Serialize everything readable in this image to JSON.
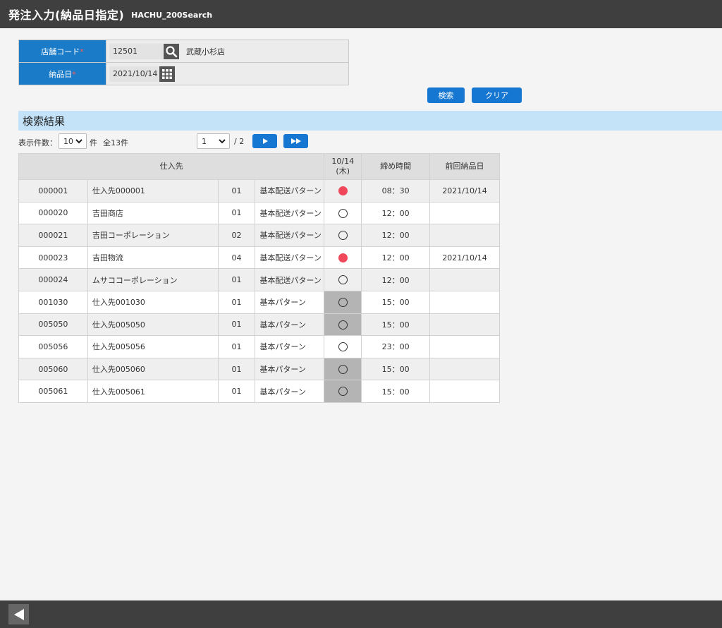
{
  "header": {
    "title": "発注入力(納品日指定)",
    "code": "HACHU_200Search"
  },
  "form": {
    "store": {
      "label": "店舗コード",
      "required_mark": "*",
      "value": "12501",
      "name": "武蔵小杉店",
      "search_icon": "search-icon"
    },
    "delivery": {
      "label": "納品日",
      "required_mark": "*",
      "value": "2021/10/14",
      "calendar_icon": "calendar-grid-icon"
    }
  },
  "actions": {
    "search_label": "検索",
    "clear_label": "クリア"
  },
  "results": {
    "title": "検索結果",
    "pager": {
      "count_label": "表示件数：",
      "count_value": "10",
      "count_unit": "件",
      "total": "全13件",
      "page_value": "1",
      "page_of": "/ 2",
      "next_icon": "play-icon",
      "last_icon": "fast-forward-icon"
    },
    "columns": {
      "supplier": "仕入先",
      "date_line1": "10/14",
      "date_line2": "(木)",
      "deadline": "締め時間",
      "prev_delivery": "前回納品日"
    },
    "rows": [
      {
        "code": "000001",
        "name": "仕入先000001",
        "pattern_no": "01",
        "pattern": "基本配送パターン",
        "mark": "filled",
        "disabled": false,
        "deadline": "08：30",
        "prev": "2021/10/14"
      },
      {
        "code": "000020",
        "name": "吉田商店",
        "pattern_no": "01",
        "pattern": "基本配送パターン",
        "mark": "open",
        "disabled": false,
        "deadline": "12：00",
        "prev": ""
      },
      {
        "code": "000021",
        "name": "吉田コーポレーション",
        "pattern_no": "02",
        "pattern": "基本配送パターン",
        "mark": "open",
        "disabled": false,
        "deadline": "12：00",
        "prev": ""
      },
      {
        "code": "000023",
        "name": "吉田物流",
        "pattern_no": "04",
        "pattern": "基本配送パターン",
        "mark": "filled",
        "disabled": false,
        "deadline": "12：00",
        "prev": "2021/10/14"
      },
      {
        "code": "000024",
        "name": "ムサココーポレーション",
        "pattern_no": "01",
        "pattern": "基本配送パターン",
        "mark": "open",
        "disabled": false,
        "deadline": "12：00",
        "prev": ""
      },
      {
        "code": "001030",
        "name": "仕入先001030",
        "pattern_no": "01",
        "pattern": "基本パターン",
        "mark": "open",
        "disabled": true,
        "deadline": "15：00",
        "prev": ""
      },
      {
        "code": "005050",
        "name": "仕入先005050",
        "pattern_no": "01",
        "pattern": "基本パターン",
        "mark": "open",
        "disabled": true,
        "deadline": "15：00",
        "prev": ""
      },
      {
        "code": "005056",
        "name": "仕入先005056",
        "pattern_no": "01",
        "pattern": "基本パターン",
        "mark": "open",
        "disabled": false,
        "deadline": "23：00",
        "prev": ""
      },
      {
        "code": "005060",
        "name": "仕入先005060",
        "pattern_no": "01",
        "pattern": "基本パターン",
        "mark": "open",
        "disabled": true,
        "deadline": "15：00",
        "prev": ""
      },
      {
        "code": "005061",
        "name": "仕入先005061",
        "pattern_no": "01",
        "pattern": "基本パターン",
        "mark": "open",
        "disabled": true,
        "deadline": "15：00",
        "prev": ""
      }
    ]
  },
  "footer": {
    "back_icon": "back-arrow-icon"
  },
  "colors": {
    "header_bg": "#3f3f3f",
    "accent": "#1677d2",
    "label_bg": "#1a7bc8",
    "section_bg": "#c4e3f8",
    "mark_on": "#f0475a",
    "disabled_cell": "#b4b4b4"
  }
}
